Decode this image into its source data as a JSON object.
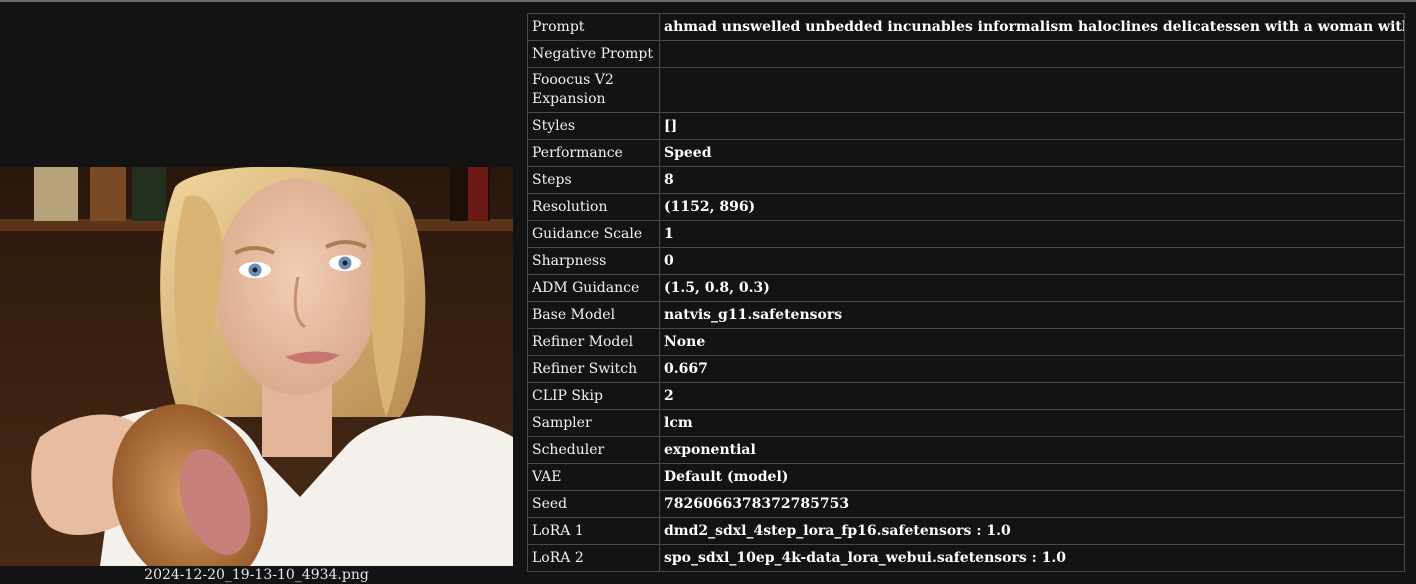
{
  "image_caption": "2024-12-20_19-13-10_4934.png",
  "colors": {
    "background": "#131313",
    "border": "#4a4a4a",
    "text": "#ffffff"
  },
  "metadata": [
    {
      "label": "Prompt",
      "value": "ahmad unswelled unbedded incunables informalism haloclines delicatessen with a woman with blue eyes"
    },
    {
      "label": "Negative Prompt",
      "value": ""
    },
    {
      "label": "Fooocus V2 Expansion",
      "value": ""
    },
    {
      "label": "Styles",
      "value": "[]"
    },
    {
      "label": "Performance",
      "value": "Speed"
    },
    {
      "label": "Steps",
      "value": "8"
    },
    {
      "label": "Resolution",
      "value": "(1152, 896)"
    },
    {
      "label": "Guidance Scale",
      "value": "1"
    },
    {
      "label": "Sharpness",
      "value": "0"
    },
    {
      "label": "ADM Guidance",
      "value": "(1.5, 0.8, 0.3)"
    },
    {
      "label": "Base Model",
      "value": "natvis_g11.safetensors"
    },
    {
      "label": "Refiner Model",
      "value": "None"
    },
    {
      "label": "Refiner Switch",
      "value": "0.667"
    },
    {
      "label": "CLIP Skip",
      "value": "2"
    },
    {
      "label": "Sampler",
      "value": "lcm"
    },
    {
      "label": "Scheduler",
      "value": "exponential"
    },
    {
      "label": "VAE",
      "value": "Default (model)"
    },
    {
      "label": "Seed",
      "value": "7826066378372785753"
    },
    {
      "label": "LoRA 1",
      "value": "dmd2_sdxl_4step_lora_fp16.safetensors : 1.0"
    },
    {
      "label": "LoRA 2",
      "value": "spo_sdxl_10ep_4k-data_lora_webui.safetensors : 1.0"
    }
  ]
}
